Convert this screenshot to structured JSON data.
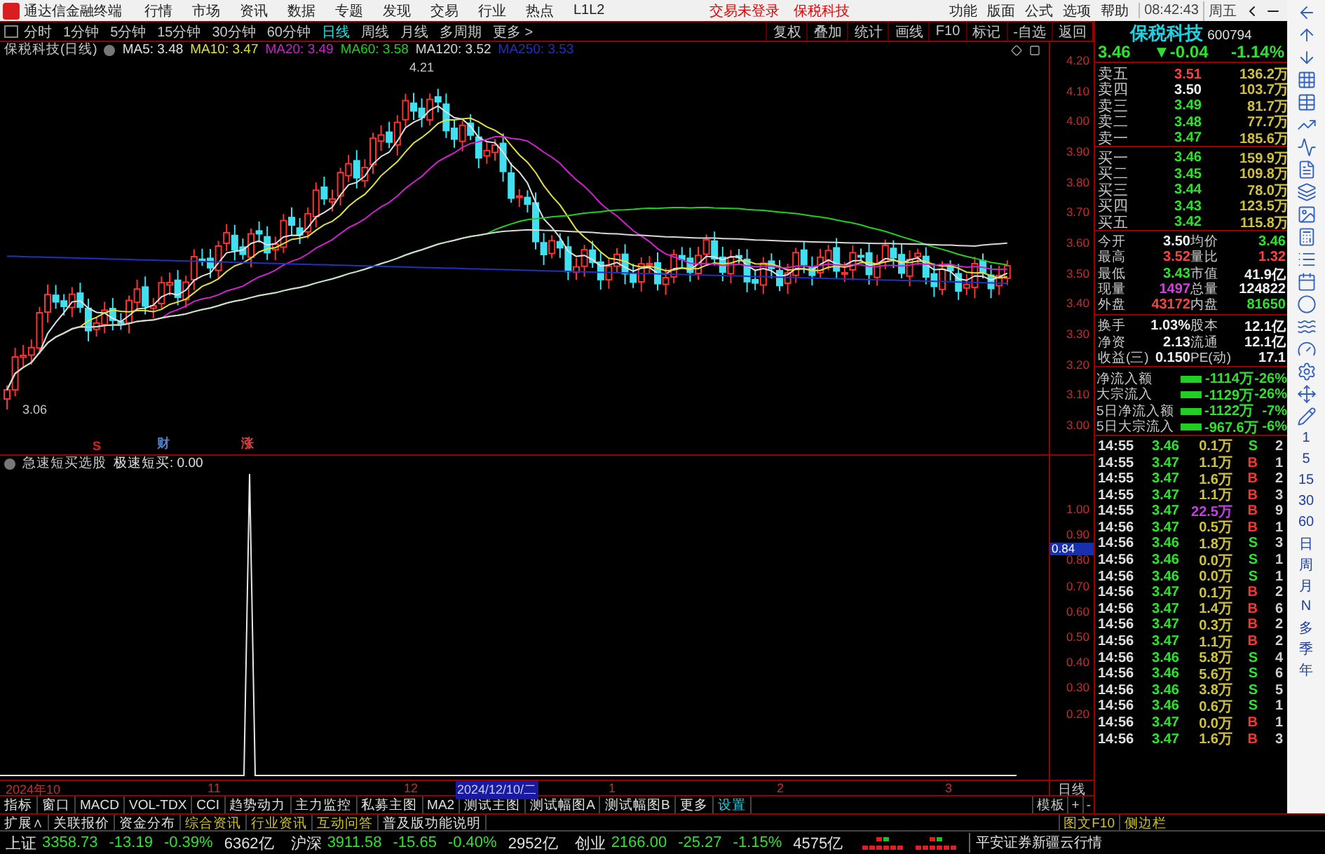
{
  "title_bar": {
    "app_title": "通达信金融终端",
    "menu": [
      "行情",
      "市场",
      "资讯",
      "数据",
      "专题",
      "发现",
      "交易",
      "行业",
      "热点",
      "L1L2"
    ],
    "notices": [
      "交易未登录",
      "保税科技"
    ],
    "right_menu": [
      "功能",
      "版面",
      "公式",
      "选项",
      "帮助"
    ],
    "time": "08:42:43",
    "weekday": "周五"
  },
  "period_tabs": [
    {
      "label": "分时",
      "selected": false
    },
    {
      "label": "1分钟",
      "selected": false
    },
    {
      "label": "5分钟",
      "selected": false
    },
    {
      "label": "15分钟",
      "selected": false
    },
    {
      "label": "30分钟",
      "selected": false
    },
    {
      "label": "60分钟",
      "selected": false
    },
    {
      "label": "日线",
      "selected": true
    },
    {
      "label": "周线",
      "selected": false
    },
    {
      "label": "月线",
      "selected": false
    },
    {
      "label": "多周期",
      "selected": false
    },
    {
      "label": "更多 >",
      "selected": false
    }
  ],
  "chart_tools": [
    "复权",
    "叠加",
    "统计",
    "画线",
    "F10",
    "标记",
    "-自选",
    "返回"
  ],
  "price_chart": {
    "title": "保税科技(日线)",
    "moving_averages": [
      {
        "label": "MA5: 3.48",
        "color": "#e0e0e0"
      },
      {
        "label": "MA10: 3.47",
        "color": "#e0e040"
      },
      {
        "label": "MA20: 3.49",
        "color": "#d020d0"
      },
      {
        "label": "MA60: 3.58",
        "color": "#20d020"
      },
      {
        "label": "MA120: 3.52",
        "color": "#d8d8d8"
      },
      {
        "label": "MA250: 3.53",
        "color": "#2030c0"
      }
    ],
    "high_label": "4.21",
    "low_label": "3.06",
    "axis_ticks": [
      "4.20",
      "4.10",
      "4.00",
      "3.90",
      "3.80",
      "3.70",
      "3.60",
      "3.50",
      "3.40",
      "3.30",
      "3.20",
      "3.10",
      "3.00"
    ],
    "event_markers": [
      {
        "label": "S",
        "kind": "signal"
      },
      {
        "label": "财",
        "kind": "finance"
      },
      {
        "label": "涨",
        "kind": "rise"
      }
    ]
  },
  "indicator": {
    "name": "急速短买选股",
    "reading": "极速短买: 0.00",
    "axis_ticks": [
      "1.00",
      "0.90",
      "0.80",
      "0.70",
      "0.60",
      "0.50",
      "0.40",
      "0.30",
      "0.20"
    ],
    "current_value": "0.84"
  },
  "date_axis": {
    "labels": [
      {
        "label": "2024年10",
        "selected": false
      },
      {
        "label": "11",
        "selected": false
      },
      {
        "label": "12",
        "selected": false
      },
      {
        "label": "2024/12/10/二",
        "selected": true
      },
      {
        "label": "1",
        "selected": false
      },
      {
        "label": "2",
        "selected": false
      },
      {
        "label": "3",
        "selected": false
      }
    ],
    "period": "日线"
  },
  "indicator_tabs": [
    {
      "label": "指标",
      "kind": "plain"
    },
    {
      "label": "窗口",
      "kind": "plain"
    },
    {
      "label": "MACD",
      "kind": "plain"
    },
    {
      "label": "VOL-TDX",
      "kind": "plain"
    },
    {
      "label": "CCI",
      "kind": "plain"
    },
    {
      "label": "趋势动力",
      "kind": "plain"
    },
    {
      "label": "主力监控",
      "kind": "plain"
    },
    {
      "label": "私募主图",
      "kind": "plain"
    },
    {
      "label": "MA2",
      "kind": "plain"
    },
    {
      "label": "测试主图",
      "kind": "plain"
    },
    {
      "label": "测试幅图A",
      "kind": "plain"
    },
    {
      "label": "测试幅图B",
      "kind": "plain"
    },
    {
      "label": "更多",
      "kind": "plain"
    },
    {
      "label": "设置",
      "kind": "link"
    }
  ],
  "template_controls": [
    "模板",
    "+",
    "-"
  ],
  "info_tabs": [
    {
      "label": "扩展∧",
      "kind": "plain"
    },
    {
      "label": "关联报价",
      "kind": "plain"
    },
    {
      "label": "资金分布",
      "kind": "plain"
    },
    {
      "label": "综合资讯",
      "kind": "news"
    },
    {
      "label": "行业资讯",
      "kind": "news"
    },
    {
      "label": "互动问答",
      "kind": "news"
    },
    {
      "label": "普及版功能说明",
      "kind": "plain"
    }
  ],
  "info_links_right": [
    "图文F10",
    "侧边栏"
  ],
  "quote": {
    "name": "保税科技",
    "code": "600794",
    "price": "3.46",
    "change": "▼-0.04",
    "change_pct": "-1.14%"
  },
  "order_book": {
    "asks": [
      {
        "label": "卖五",
        "price": "3.51",
        "volume": "136.2万",
        "kind": "up"
      },
      {
        "label": "卖四",
        "price": "3.50",
        "volume": "103.7万",
        "kind": "flat"
      },
      {
        "label": "卖三",
        "price": "3.49",
        "volume": "81.7万",
        "kind": "down"
      },
      {
        "label": "卖二",
        "price": "3.48",
        "volume": "77.7万",
        "kind": "down"
      },
      {
        "label": "卖一",
        "price": "3.47",
        "volume": "185.6万",
        "kind": "down"
      }
    ],
    "bids": [
      {
        "label": "买一",
        "price": "3.46",
        "volume": "159.9万",
        "kind": "down"
      },
      {
        "label": "买二",
        "price": "3.45",
        "volume": "109.8万",
        "kind": "down"
      },
      {
        "label": "买三",
        "price": "3.44",
        "volume": "78.0万",
        "kind": "down"
      },
      {
        "label": "买四",
        "price": "3.43",
        "volume": "123.5万",
        "kind": "down"
      },
      {
        "label": "买五",
        "price": "3.42",
        "volume": "115.8万",
        "kind": "down"
      }
    ]
  },
  "stats": [
    [
      {
        "label": "今开",
        "value": "3.50",
        "kind": "flat"
      },
      {
        "label": "均价",
        "value": "3.46",
        "kind": "down"
      }
    ],
    [
      {
        "label": "最高",
        "value": "3.52",
        "kind": "up"
      },
      {
        "label": "量比",
        "value": "1.32",
        "kind": "up"
      }
    ],
    [
      {
        "label": "最低",
        "value": "3.43",
        "kind": "down"
      },
      {
        "label": "市值",
        "value": "41.9亿",
        "kind": "flat"
      }
    ],
    [
      {
        "label": "现量",
        "value": "1497",
        "kind": "volume"
      },
      {
        "label": "总量",
        "value": "124822",
        "kind": "flat"
      }
    ],
    [
      {
        "label": "外盘",
        "value": "43172",
        "kind": "up"
      },
      {
        "label": "内盘",
        "value": "81650",
        "kind": "down"
      }
    ]
  ],
  "valuation": [
    [
      {
        "label": "换手",
        "value": "1.03%",
        "kind": "flat"
      },
      {
        "label": "股本",
        "value": "12.1亿",
        "kind": "flat"
      }
    ],
    [
      {
        "label": "净资",
        "value": "2.13",
        "kind": "flat"
      },
      {
        "label": "流通",
        "value": "12.1亿",
        "kind": "flat"
      }
    ],
    [
      {
        "label": "收益(三)",
        "value": "0.150",
        "kind": "flat"
      },
      {
        "label": "PE(动)",
        "value": "17.1",
        "kind": "flat"
      }
    ]
  ],
  "fund_flow": [
    {
      "label": "净流入额",
      "amount": "-1114万",
      "pct": "-26%"
    },
    {
      "label": "大宗流入",
      "amount": "-1129万",
      "pct": "-26%"
    },
    {
      "label": "5日净流入额",
      "amount": "-1122万",
      "pct": "-7%"
    },
    {
      "label": "5日大宗流入",
      "amount": "-967.6万",
      "pct": "-6%"
    }
  ],
  "trades": [
    {
      "time": "14:55",
      "price": "3.46",
      "volume": "0.1万",
      "side": "S",
      "kind": "sell",
      "count": "2",
      "large": false
    },
    {
      "time": "14:55",
      "price": "3.47",
      "volume": "1.1万",
      "side": "B",
      "kind": "buy",
      "count": "1",
      "large": false
    },
    {
      "time": "14:55",
      "price": "3.47",
      "volume": "1.6万",
      "side": "B",
      "kind": "buy",
      "count": "2",
      "large": false
    },
    {
      "time": "14:55",
      "price": "3.47",
      "volume": "1.1万",
      "side": "B",
      "kind": "buy",
      "count": "3",
      "large": false
    },
    {
      "time": "14:55",
      "price": "3.47",
      "volume": "22.5万",
      "side": "B",
      "kind": "buy",
      "count": "9",
      "large": true
    },
    {
      "time": "14:56",
      "price": "3.47",
      "volume": "0.5万",
      "side": "B",
      "kind": "buy",
      "count": "1",
      "large": false
    },
    {
      "time": "14:56",
      "price": "3.46",
      "volume": "1.8万",
      "side": "S",
      "kind": "sell",
      "count": "3",
      "large": false
    },
    {
      "time": "14:56",
      "price": "3.46",
      "volume": "0.0万",
      "side": "S",
      "kind": "sell",
      "count": "1",
      "large": false
    },
    {
      "time": "14:56",
      "price": "3.46",
      "volume": "0.0万",
      "side": "S",
      "kind": "sell",
      "count": "1",
      "large": false
    },
    {
      "time": "14:56",
      "price": "3.47",
      "volume": "0.1万",
      "side": "B",
      "kind": "buy",
      "count": "2",
      "large": false
    },
    {
      "time": "14:56",
      "price": "3.47",
      "volume": "1.4万",
      "side": "B",
      "kind": "buy",
      "count": "6",
      "large": false
    },
    {
      "time": "14:56",
      "price": "3.47",
      "volume": "0.3万",
      "side": "B",
      "kind": "buy",
      "count": "2",
      "large": false
    },
    {
      "time": "14:56",
      "price": "3.47",
      "volume": "1.1万",
      "side": "B",
      "kind": "buy",
      "count": "2",
      "large": false
    },
    {
      "time": "14:56",
      "price": "3.46",
      "volume": "5.8万",
      "side": "S",
      "kind": "sell",
      "count": "4",
      "large": false
    },
    {
      "time": "14:56",
      "price": "3.46",
      "volume": "5.6万",
      "side": "S",
      "kind": "sell",
      "count": "6",
      "large": false
    },
    {
      "time": "14:56",
      "price": "3.46",
      "volume": "3.8万",
      "side": "S",
      "kind": "sell",
      "count": "5",
      "large": false
    },
    {
      "time": "14:56",
      "price": "3.46",
      "volume": "0.6万",
      "side": "S",
      "kind": "sell",
      "count": "1",
      "large": false
    },
    {
      "time": "14:56",
      "price": "3.47",
      "volume": "0.0万",
      "side": "B",
      "kind": "buy",
      "count": "1",
      "large": false
    },
    {
      "time": "14:56",
      "price": "3.47",
      "volume": "1.6万",
      "side": "B",
      "kind": "buy",
      "count": "3",
      "large": false
    }
  ],
  "side_periods": [
    "1",
    "5",
    "15",
    "30",
    "60",
    "日",
    "周",
    "月",
    "N",
    "多",
    "季",
    "年"
  ],
  "market_indices": [
    {
      "name": "上证",
      "value": "3358.73",
      "change": "-13.19",
      "pct": "-0.39%",
      "turnover": "6362亿"
    },
    {
      "name": "沪深",
      "value": "3911.58",
      "change": "-15.65",
      "pct": "-0.40%",
      "turnover": "2952亿"
    },
    {
      "name": "创业",
      "value": "2166.00",
      "change": "-25.27",
      "pct": "-1.15%",
      "turnover": "4575亿"
    }
  ],
  "broker": "平安证券新疆云行情"
}
